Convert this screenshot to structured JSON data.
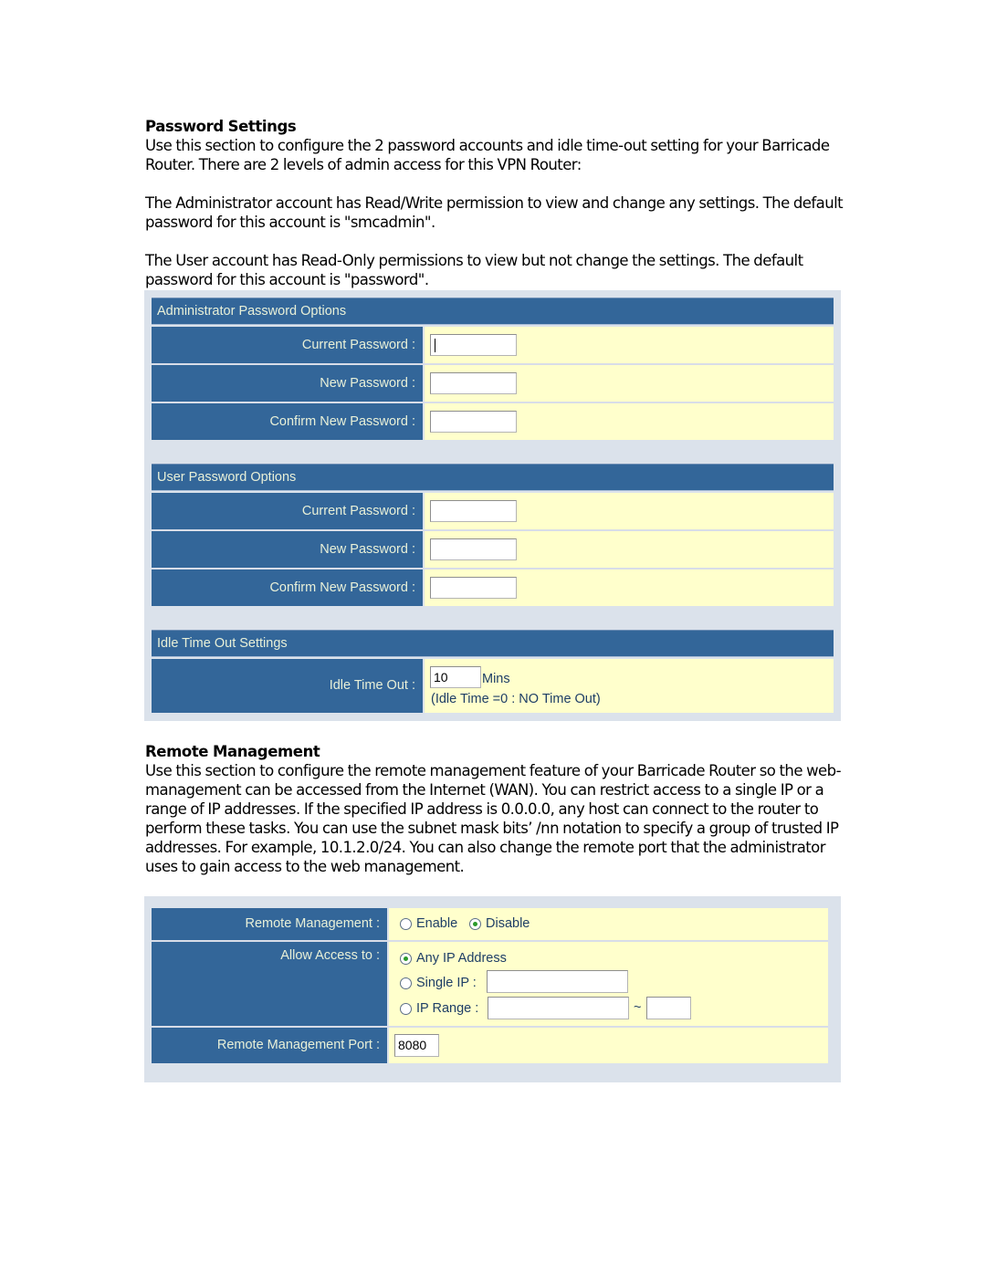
{
  "password_section": {
    "heading": "Password Settings",
    "intro": "Use this section to configure the 2 password accounts and idle time-out setting for your Barricade Router. There are 2 levels of admin access for this VPN Router:",
    "admin_desc": "The Administrator account has Read/Write permission to view and change any settings. The default password for this account is \"smcadmin\".",
    "user_desc": "The User account has Read-Only permissions to view but not change the settings. The default password for this account is \"password\"."
  },
  "admin_options": {
    "title": "Administrator Password Options",
    "fields": [
      {
        "label": "Current Password :",
        "value": ""
      },
      {
        "label": "New Password :",
        "value": ""
      },
      {
        "label": "Confirm New Password :",
        "value": ""
      }
    ]
  },
  "user_options": {
    "title": "User Password Options",
    "fields": [
      {
        "label": "Current Password :",
        "value": ""
      },
      {
        "label": "New Password :",
        "value": ""
      },
      {
        "label": "Confirm New Password :",
        "value": ""
      }
    ]
  },
  "idle_options": {
    "title": "Idle Time Out Settings",
    "label": "Idle Time Out :",
    "value": "10",
    "unit": "Mins",
    "hint": "(Idle Time =0 : NO Time Out)"
  },
  "remote_section": {
    "heading": "Remote Management",
    "description": "Use this section to configure the remote management feature of your Barricade Router so the web-management can be accessed from the Internet (WAN). You can restrict access to a single IP or a range of IP addresses. If the specified IP address is 0.0.0.0, any host can connect to the router to perform these tasks. You can use the subnet mask bits’ /nn notation to specify a group of trusted IP addresses. For example, 10.1.2.0/24. You can also change the remote port that the administrator uses to gain access to the web management."
  },
  "remote_form": {
    "remote_mgmt_label": "Remote Management :",
    "enable_label": "Enable",
    "disable_label": "Disable",
    "remote_mgmt_selected": "Disable",
    "allow_access_label": "Allow Access to :",
    "any_ip_label": "Any IP Address",
    "single_ip_label": "Single IP :",
    "single_ip_value": "",
    "ip_range_label": "IP Range :",
    "ip_range_start": "",
    "ip_range_sep": "~",
    "ip_range_end": "",
    "access_selected": "Any IP Address",
    "port_label": "Remote Management Port :",
    "port_value": "8080"
  }
}
